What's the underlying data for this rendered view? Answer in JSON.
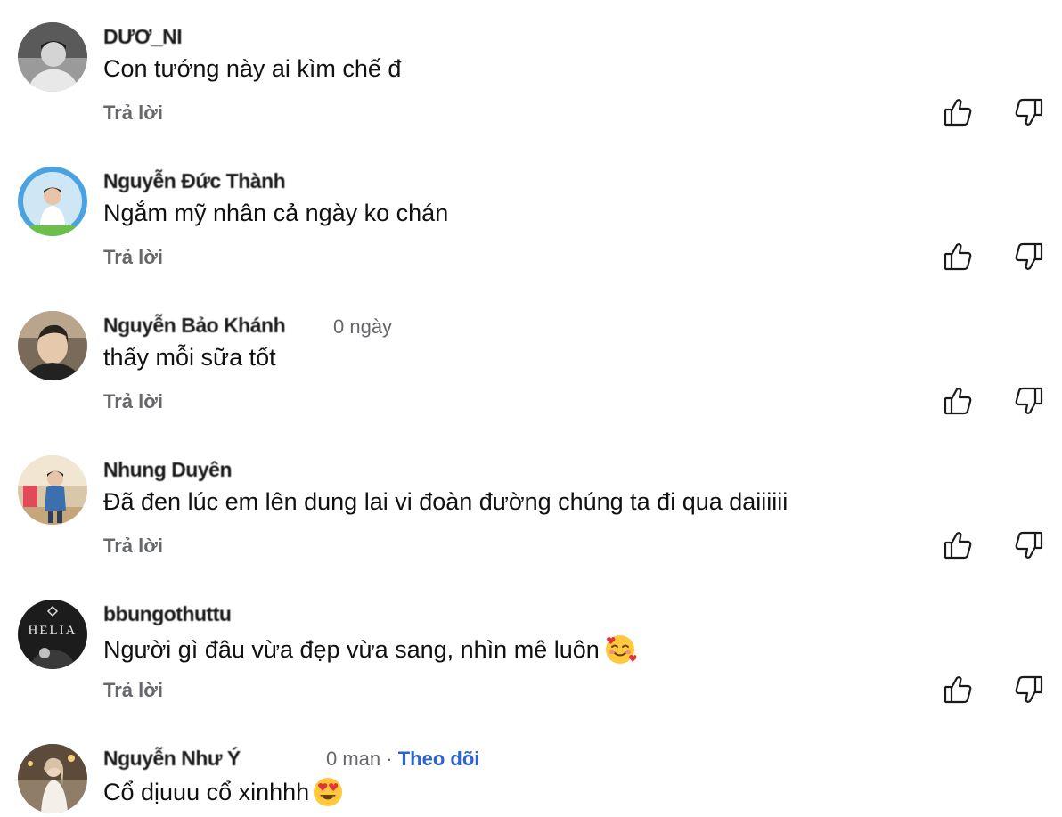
{
  "comments": [
    {
      "author": "DƯƠ_NI",
      "text": "Con tướng này ai kìm chế đ",
      "reply_label": "Trả lời"
    },
    {
      "author": "Nguyễn Đức Thành",
      "text": "Ngắm mỹ nhân cả ngày ko chán",
      "reply_label": "Trả lời"
    },
    {
      "author": "Nguyễn Bảo Khánh",
      "meta": "0 ngày",
      "text": "thấy mỗi sữa tốt",
      "reply_label": "Trả lời"
    },
    {
      "author": "Nhung Duyên",
      "text": "Đã đen lúc em lên dung lai vi đoàn đường chúng ta đi qua daiiiiii",
      "reply_label": "Trả lời"
    },
    {
      "author": "bbungothuttu",
      "text": "Người gì đâu vừa đẹp vừa sang, nhìn mê luôn",
      "emoji": "smiling-face-with-hearts",
      "reply_label": "Trả lời"
    },
    {
      "author": "Nguyễn Như Ý",
      "meta": "0 man",
      "separator": "·",
      "follow_label": "Theo dõi",
      "text": "Cổ dịuuu cổ xinhhh",
      "emoji": "heart-eyes"
    }
  ],
  "avatar_labels": {
    "helia": "HELIA"
  },
  "colors": {
    "text": "#111111",
    "secondary": "#65676b",
    "link": "#2e64d1",
    "background": "#ffffff"
  },
  "icons": {
    "like": "thumbs-up-icon",
    "dislike": "thumbs-down-icon"
  }
}
